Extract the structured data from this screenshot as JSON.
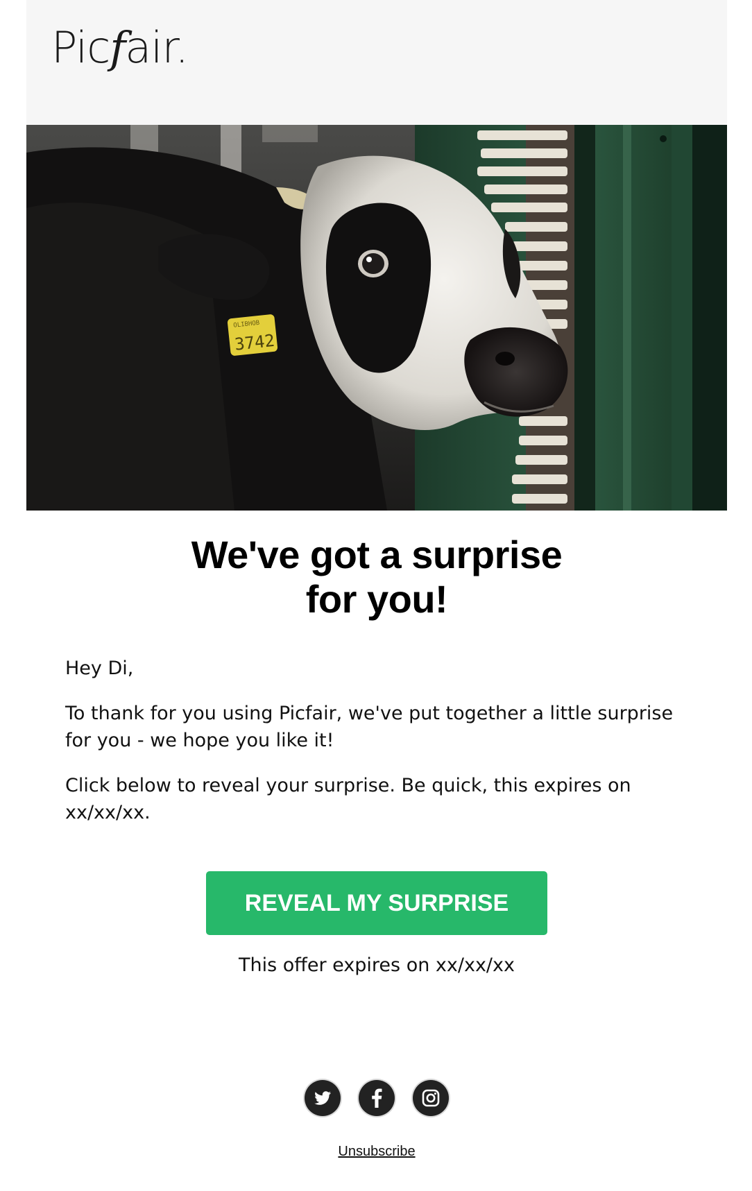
{
  "brand": {
    "logo_text_start": "Pic",
    "logo_text_script": "f",
    "logo_text_end": "air."
  },
  "hero": {
    "ear_tag_top": "OLIBHOB",
    "ear_tag_number": "3742"
  },
  "headline": {
    "line1": "We've got a surprise",
    "line2": "for you!"
  },
  "body": {
    "greeting": "Hey Di,",
    "paragraph1": "To thank for you using Picfair, we've put together a little surprise for you - we hope you like it!",
    "paragraph2": "Click below to reveal your surprise. Be quick, this expires on xx/xx/xx."
  },
  "cta": {
    "label": "REVEAL MY SURPRISE",
    "color": "#27b86a"
  },
  "offer": {
    "expiry_text": "This offer expires on xx/xx/xx"
  },
  "social": {
    "icons": [
      "twitter-icon",
      "facebook-icon",
      "instagram-icon"
    ]
  },
  "footer": {
    "unsubscribe_label": "Unsubscribe"
  }
}
